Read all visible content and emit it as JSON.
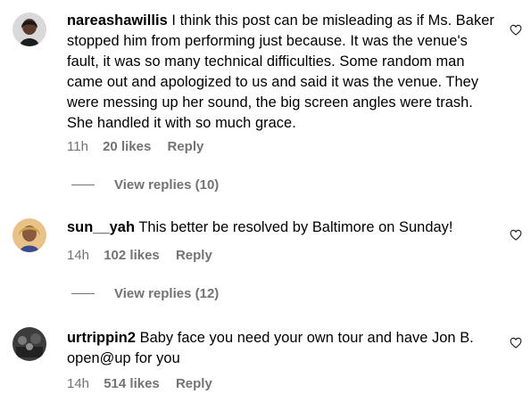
{
  "comments": [
    {
      "username": "nareashawillis",
      "text": "I think this post can be misleading as if Ms. Baker stopped him from performing just because. It was the venue's fault, it was so many technical difficulties. Some random man came out and apologized to us and said it was the venue. They were messing up her sound, the big screen angles were trash. She handled it with so much grace.",
      "time": "11h",
      "likes": "20 likes",
      "reply": "Reply",
      "view_replies": "View replies (10)"
    },
    {
      "username": "sun__yah",
      "text": "This better be resolved by Baltimore on Sunday!",
      "time": "14h",
      "likes": "102 likes",
      "reply": "Reply",
      "view_replies": "View replies (12)"
    },
    {
      "username": "urtrippin2",
      "text": "Baby face you need your own tour and have Jon B. open@up for you",
      "time": "14h",
      "likes": "514 likes",
      "reply": "Reply"
    }
  ],
  "icons": {
    "like": "heart-outline-icon"
  },
  "colors": {
    "text": "#000000",
    "meta": "#737373"
  }
}
